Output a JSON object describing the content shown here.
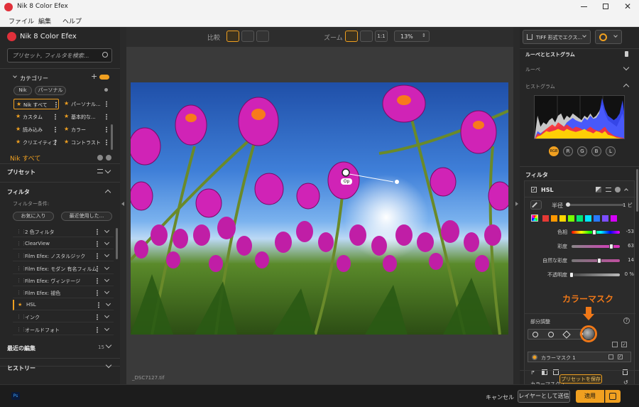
{
  "window": {
    "title": "Nik 8 Color Efex"
  },
  "menu": [
    "ファイル",
    "編集",
    "ヘルプ"
  ],
  "left": {
    "app_title": "Nik 8 Color Efex",
    "search_placeholder": "プリセット, フィルタを検索...",
    "categories_label": "カテゴリー",
    "chips": [
      "Nik",
      "パーソナル"
    ],
    "grid": [
      {
        "label": "Nik すべて",
        "starred": true
      },
      {
        "label": "パーソナル...",
        "starred": true
      },
      {
        "label": "カスタム",
        "starred": true
      },
      {
        "label": "基本的な...",
        "starred": true
      },
      {
        "label": "読み込み",
        "starred": true
      },
      {
        "label": "カラー",
        "starred": true
      },
      {
        "label": "クリエイティブ",
        "starred": true
      },
      {
        "label": "コントラスト",
        "starred": true
      }
    ],
    "selected_category": "Nik すべて",
    "presets_label": "プリセット",
    "filters_label": "フィルタ",
    "filter_condition": "フィルター条件:",
    "filter_pills": [
      "お気に入り",
      "最近使用した..."
    ],
    "filter_list": [
      "2 色フィルタ",
      "ClearView",
      "Film Efex: ノスタルジック",
      "Film Efex: モダン 有名フィルム",
      "Film Efex: ヴィンテージ",
      "Film Efex: 褪色",
      "HSL",
      "インク",
      "オールドフォト"
    ],
    "recent_label": "最近の編集",
    "recent_count": "15",
    "history_label": "ヒストリー"
  },
  "toolbar": {
    "compare_label": "比較",
    "zoom_label": "ズーム",
    "zoom_1to1": "1:1",
    "zoom_value": "13%"
  },
  "canvas": {
    "filename": "_DSC7127.tif",
    "control_point_label": "Op"
  },
  "right": {
    "export_label": "TIFF 形式でエクス...",
    "loupe_hist_label": "ルーペとヒストグラム",
    "loupe_label": "ルーペ",
    "histogram_label": "ヒストグラム",
    "channels": [
      "RGB",
      "R",
      "G",
      "B",
      "L"
    ],
    "filter_section": "フィルタ",
    "filter_name": "HSL",
    "radius_label": "半径",
    "radius_value": "1 ピ",
    "swatches": [
      "#e53935",
      "#ff9800",
      "#ffd600",
      "#76ff03",
      "#00e676",
      "#00e5ff",
      "#2979ff",
      "#7c4dff",
      "#d500f9"
    ],
    "sliders": [
      {
        "label": "色相",
        "value": "-53",
        "level": 0.47
      },
      {
        "label": "彩度",
        "value": "63",
        "level": 0.82
      },
      {
        "label": "自然な彩度",
        "value": "14",
        "level": 0.57
      },
      {
        "label": "不透明度",
        "value": "0 %",
        "level": 0.0
      }
    ],
    "partial_label": "部分調整",
    "annotation": "カラーマスク",
    "mask_item": "カラーマスク 1",
    "mask_detail": "カラーマスク 1",
    "save_preset": "プリセットを保存"
  },
  "footer": {
    "ps_badge": "Ps",
    "cancel": "キャンセル",
    "send_layer": "レイヤーとして送信",
    "apply": "適用"
  },
  "colors": {
    "accent": "#f0a020",
    "annotation": "#f07818",
    "bg": "#262626"
  },
  "chart_data": {
    "type": "area",
    "title": "",
    "xlabel": "",
    "ylabel": "",
    "x": [
      0,
      1,
      2,
      3,
      4,
      5,
      6,
      7,
      8,
      9,
      10,
      11,
      12,
      13,
      14,
      15,
      16,
      17,
      18,
      19,
      20,
      21,
      22,
      23,
      24,
      25,
      26,
      27,
      28,
      29,
      30,
      31
    ],
    "xlim": [
      0,
      31
    ],
    "ylim": [
      0,
      1
    ],
    "grid": true,
    "series": [
      {
        "color": "#e8e8e8",
        "values": [
          0.05,
          0.55,
          0.3,
          0.4,
          0.35,
          0.45,
          0.5,
          0.4,
          0.55,
          0.6,
          0.45,
          0.55,
          0.5,
          0.6,
          0.55,
          0.5,
          0.45,
          0.55,
          0.5,
          0.6,
          0.5,
          0.55,
          0.65,
          0.8,
          0.6,
          0.45,
          0.4,
          0.35,
          0.3,
          0.45,
          0.6,
          0.3
        ]
      },
      {
        "color": "#3a4dff",
        "values": [
          0.02,
          0.2,
          0.15,
          0.2,
          0.18,
          0.25,
          0.3,
          0.28,
          0.3,
          0.35,
          0.3,
          0.4,
          0.45,
          0.5,
          0.45,
          0.42,
          0.4,
          0.5,
          0.45,
          0.55,
          0.48,
          0.5,
          0.6,
          0.95,
          0.7,
          0.55,
          0.5,
          0.45,
          0.5,
          0.6,
          0.9,
          0.4
        ]
      },
      {
        "color": "#ff3030",
        "values": [
          0.02,
          0.15,
          0.12,
          0.2,
          0.25,
          0.3,
          0.35,
          0.3,
          0.4,
          0.35,
          0.3,
          0.35,
          0.3,
          0.25,
          0.3,
          0.28,
          0.25,
          0.2,
          0.25,
          0.3,
          0.25,
          0.22,
          0.2,
          0.25,
          0.3,
          0.2,
          0.15,
          0.1,
          0.08,
          0.06,
          0.05,
          0.02
        ]
      },
      {
        "color": "#ffe000",
        "values": [
          0.01,
          0.08,
          0.1,
          0.15,
          0.2,
          0.18,
          0.2,
          0.22,
          0.25,
          0.22,
          0.2,
          0.25,
          0.22,
          0.2,
          0.18,
          0.2,
          0.22,
          0.25,
          0.2,
          0.18,
          0.15,
          0.2,
          0.18,
          0.15,
          0.2,
          0.12,
          0.1,
          0.08,
          0.05,
          0.04,
          0.03,
          0.01
        ]
      }
    ]
  }
}
